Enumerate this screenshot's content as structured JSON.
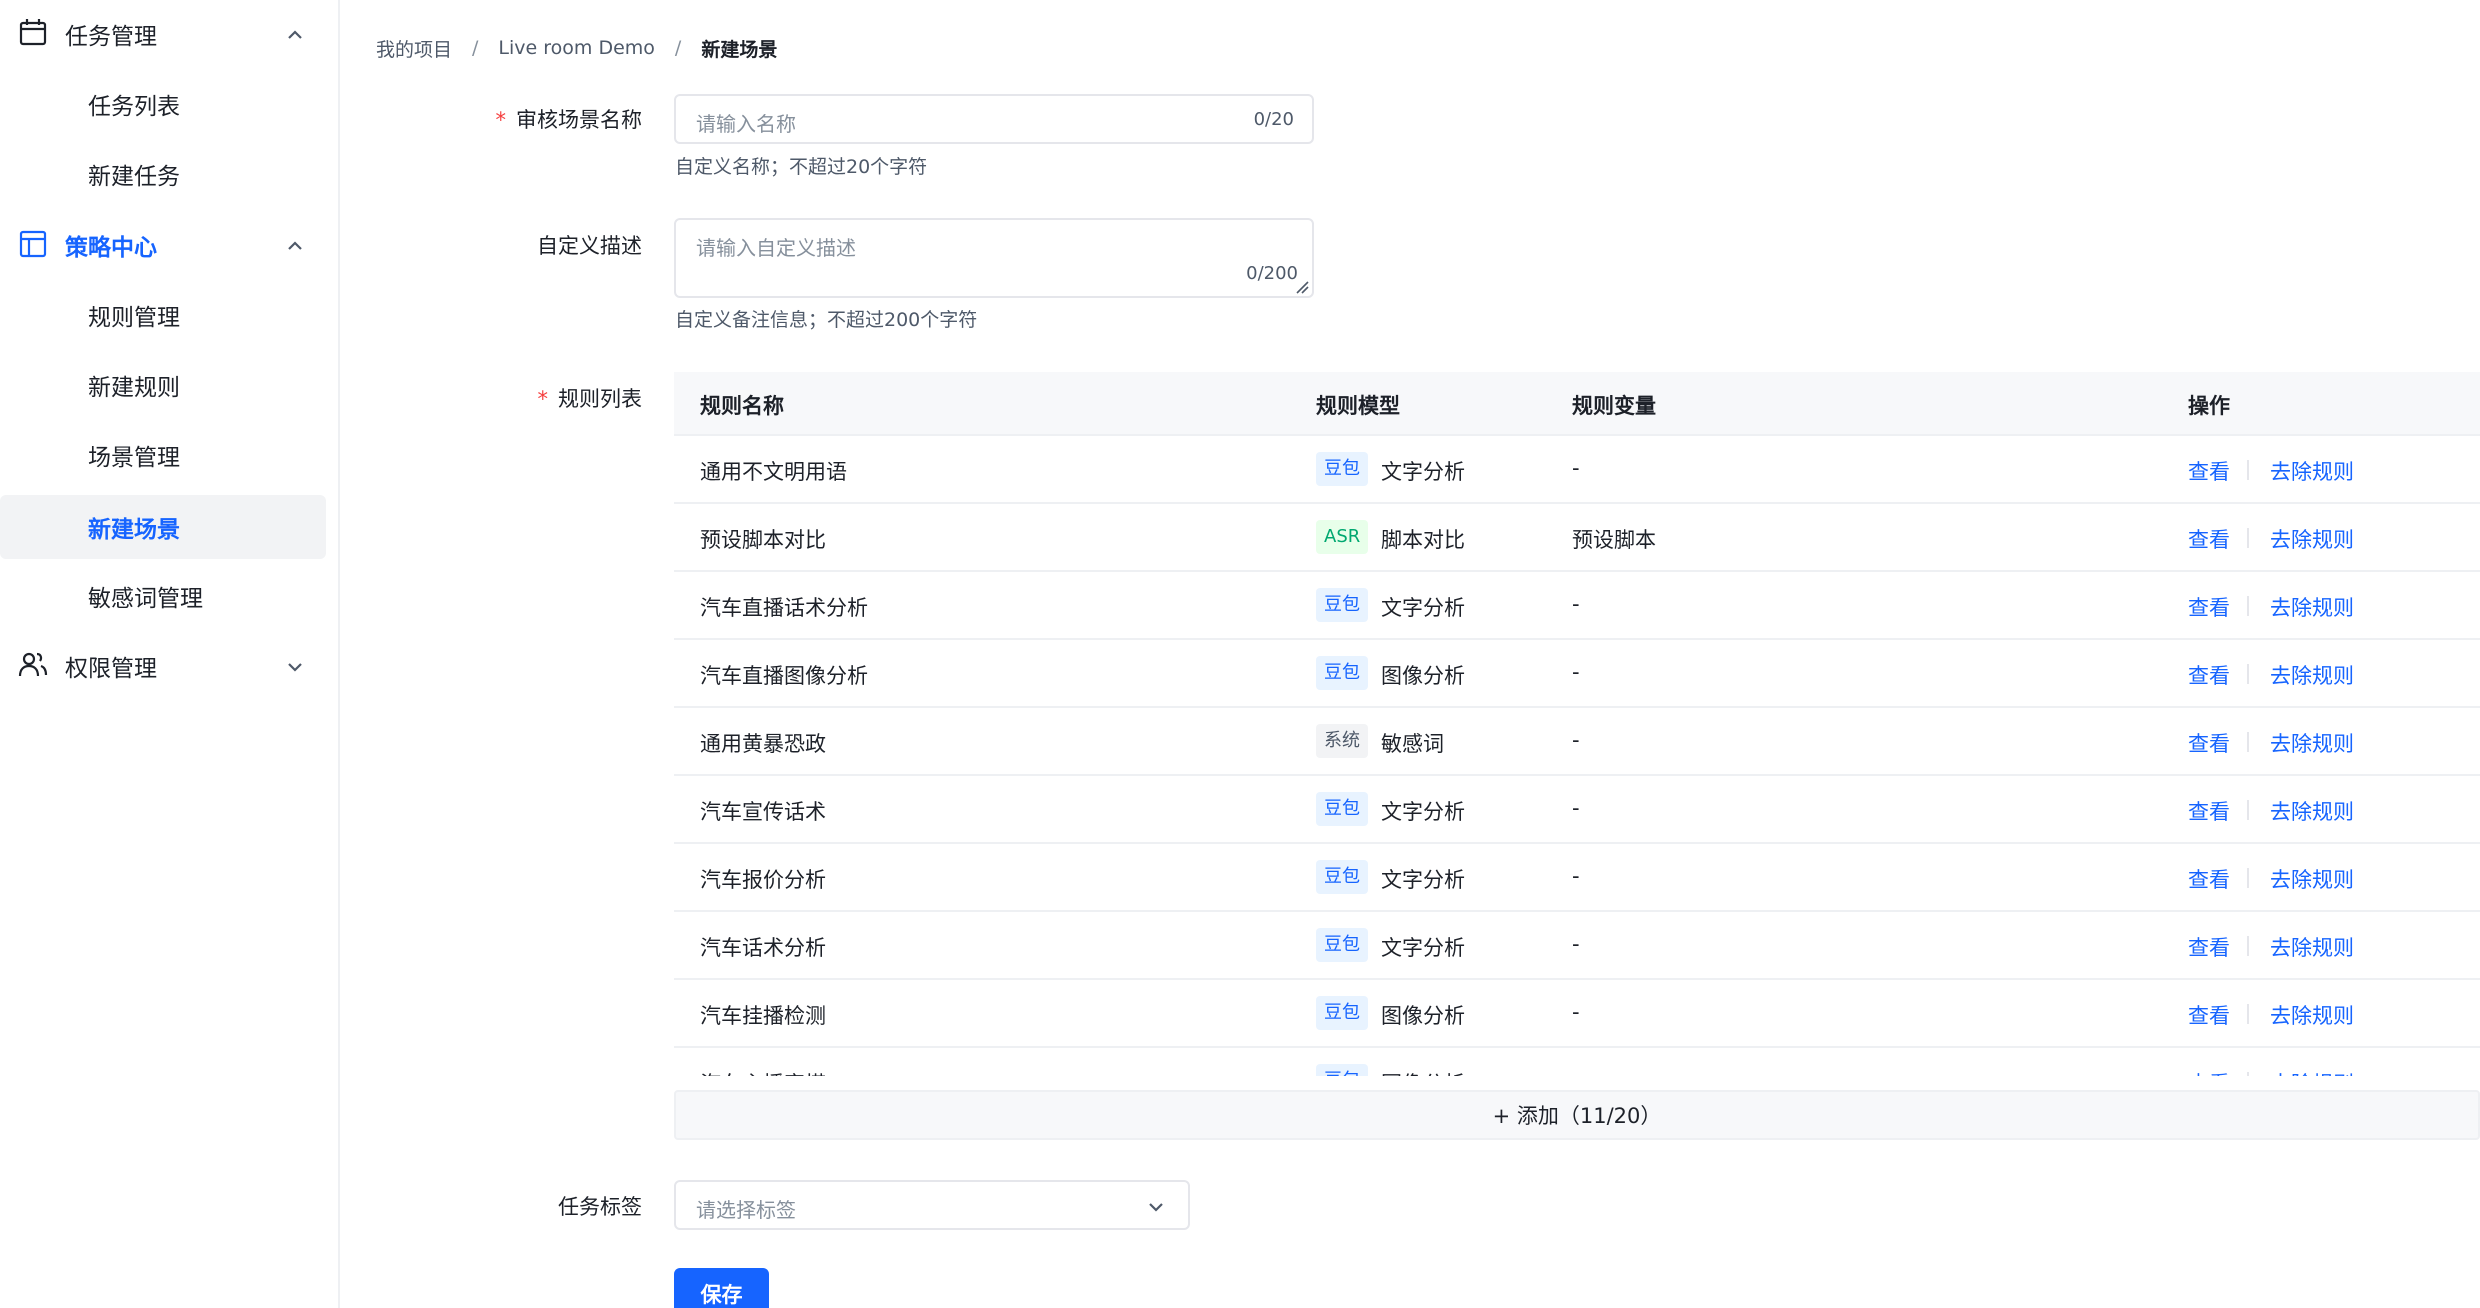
{
  "colors": {
    "primary": "#1664ff",
    "required": "#f53f3f"
  },
  "sidebar": {
    "groups": [
      {
        "label": "任务管理",
        "icon": "calendar-icon",
        "expanded": true,
        "items": [
          {
            "label": "任务列表"
          },
          {
            "label": "新建任务"
          }
        ]
      },
      {
        "label": "策略中心",
        "icon": "layout-icon",
        "expanded": true,
        "active": true,
        "items": [
          {
            "label": "规则管理"
          },
          {
            "label": "新建规则"
          },
          {
            "label": "场景管理"
          },
          {
            "label": "新建场景",
            "active": true
          },
          {
            "label": "敏感词管理"
          }
        ]
      },
      {
        "label": "权限管理",
        "icon": "users-icon",
        "expanded": false,
        "items": []
      }
    ]
  },
  "breadcrumb": {
    "items": [
      "我的项目",
      "Live room Demo",
      "新建场景"
    ],
    "separator": "/"
  },
  "form": {
    "name": {
      "label": "审核场景名称",
      "placeholder": "请输入名称",
      "counter": "0/20",
      "hint": "自定义名称；不超过20个字符"
    },
    "description": {
      "label": "自定义描述",
      "placeholder": "请输入自定义描述",
      "counter": "0/200",
      "hint": "自定义备注信息；不超过200个字符"
    },
    "rules": {
      "label": "规则列表",
      "columns": [
        "规则名称",
        "规则模型",
        "规则变量",
        "操作"
      ],
      "rows": [
        {
          "name": "通用不文明用语",
          "tag": "豆包",
          "tag_type": "doubao",
          "model": "文字分析",
          "variable": "-",
          "view": "查看",
          "remove": "去除规则"
        },
        {
          "name": "预设脚本对比",
          "tag": "ASR",
          "tag_type": "asr",
          "model": "脚本对比",
          "variable": "预设脚本",
          "view": "查看",
          "remove": "去除规则"
        },
        {
          "name": "汽车直播话术分析",
          "tag": "豆包",
          "tag_type": "doubao",
          "model": "文字分析",
          "variable": "-",
          "view": "查看",
          "remove": "去除规则"
        },
        {
          "name": "汽车直播图像分析",
          "tag": "豆包",
          "tag_type": "doubao",
          "model": "图像分析",
          "variable": "-",
          "view": "查看",
          "remove": "去除规则"
        },
        {
          "name": "通用黄暴恐政",
          "tag": "系统",
          "tag_type": "sys",
          "model": "敏感词",
          "variable": "-",
          "view": "查看",
          "remove": "去除规则"
        },
        {
          "name": "汽车宣传话术",
          "tag": "豆包",
          "tag_type": "doubao",
          "model": "文字分析",
          "variable": "-",
          "view": "查看",
          "remove": "去除规则"
        },
        {
          "name": "汽车报价分析",
          "tag": "豆包",
          "tag_type": "doubao",
          "model": "文字分析",
          "variable": "-",
          "view": "查看",
          "remove": "去除规则"
        },
        {
          "name": "汽车话术分析",
          "tag": "豆包",
          "tag_type": "doubao",
          "model": "文字分析",
          "variable": "-",
          "view": "查看",
          "remove": "去除规则"
        },
        {
          "name": "汽车挂播检测",
          "tag": "豆包",
          "tag_type": "doubao",
          "model": "图像分析",
          "variable": "-",
          "view": "查看",
          "remove": "去除规则"
        },
        {
          "name": "汽车主播穿搭",
          "tag": "豆包",
          "tag_type": "doubao",
          "model": "图像分析",
          "variable": "-",
          "view": "查看",
          "remove": "去除规则"
        }
      ],
      "add_label": "+ 添加（11/20）"
    },
    "tags": {
      "label": "任务标签",
      "placeholder": "请选择标签"
    },
    "save_label": "保存"
  }
}
